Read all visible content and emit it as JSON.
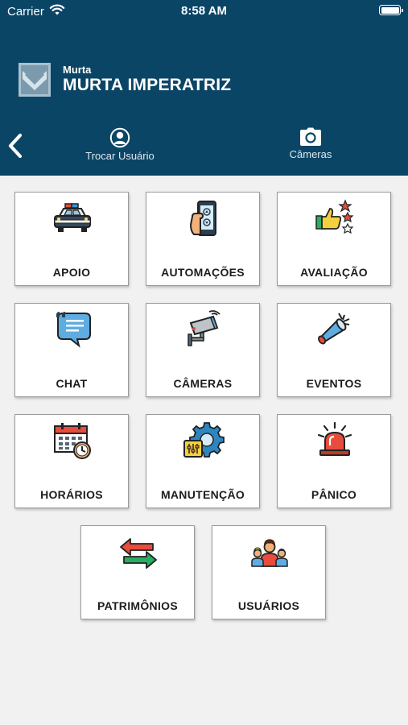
{
  "status_bar": {
    "carrier": "Carrier",
    "time": "8:58 AM"
  },
  "header": {
    "subtitle": "Murta",
    "title": "MURTA IMPERATRIZ",
    "actions": [
      {
        "label": "Trocar Usuário",
        "icon": "user-circle-icon"
      },
      {
        "label": "Câmeras",
        "icon": "camera-icon"
      }
    ],
    "background_color": "#0b4566"
  },
  "tiles": [
    {
      "label": "APOIO",
      "icon": "police-car-icon"
    },
    {
      "label": "AUTOMAÇÕES",
      "icon": "smartphone-remote-icon"
    },
    {
      "label": "AVALIAÇÃO",
      "icon": "thumbs-up-stars-icon"
    },
    {
      "label": "CHAT",
      "icon": "chat-bubble-icon"
    },
    {
      "label": "CÂMERAS",
      "icon": "security-camera-icon"
    },
    {
      "label": "EVENTOS",
      "icon": "megaphone-icon"
    },
    {
      "label": "HORÁRIOS",
      "icon": "calendar-clock-icon"
    },
    {
      "label": "MANUTENÇÃO",
      "icon": "gear-panel-icon"
    },
    {
      "label": "PÂNICO",
      "icon": "siren-icon"
    },
    {
      "label": "PATRIMÔNIOS",
      "icon": "exchange-arrows-icon"
    },
    {
      "label": "USUÁRIOS",
      "icon": "users-group-icon"
    }
  ]
}
